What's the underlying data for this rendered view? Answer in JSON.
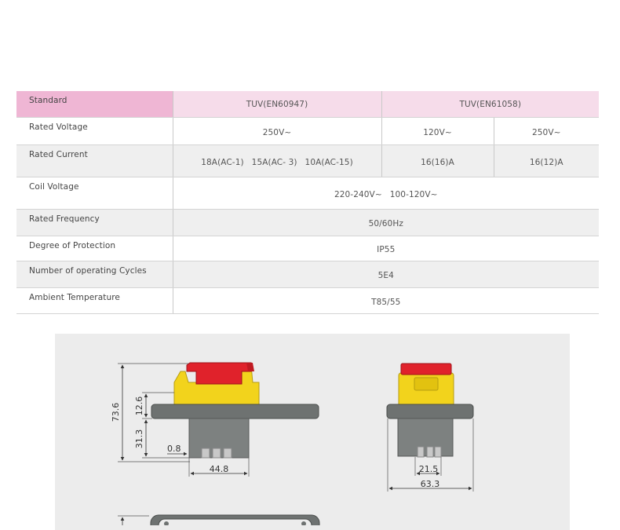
{
  "table": {
    "header": {
      "label": "Standard",
      "col1": "TUV(EN60947)",
      "col2": "TUV(EN61058)"
    },
    "rated_voltage": {
      "label": "Rated Voltage",
      "v1": "250V~",
      "v2": "120V~",
      "v3": "250V~"
    },
    "rated_current": {
      "label": "Rated  Current",
      "v1a": "18A(AC-1)",
      "v1b": "15A(AC- 3)",
      "v1c": "10A(AC-15)",
      "v2": "16(16)A",
      "v3": "16(12)A"
    },
    "coil_voltage": {
      "label": "Coil  Voltage",
      "v1": "220-240V~",
      "v2": "100-120V~"
    },
    "rated_frequency": {
      "label": "Rated  Frequency",
      "value": "50/60Hz"
    },
    "degree_of_protection": {
      "label": "Degree  of  Protection",
      "value": "IP55"
    },
    "operating_cycles": {
      "label": "Number  of  operating  Cycles",
      "value": "5E4"
    },
    "ambient_temperature": {
      "label": "Ambient  Temperature",
      "value": "T85/55"
    }
  },
  "drawing": {
    "dims": {
      "total_height": "73.6",
      "upper_height": "12.6",
      "lower_height": "31.3",
      "offset": "0.8",
      "side_width": "44.8",
      "terminal_width": "21.5",
      "front_width": "63.3"
    },
    "colors": {
      "red": "#e0222b",
      "yellow": "#f2d31c",
      "housing": "#6e7271",
      "body": "#7d8180",
      "terminal": "#c8c8c8"
    }
  }
}
